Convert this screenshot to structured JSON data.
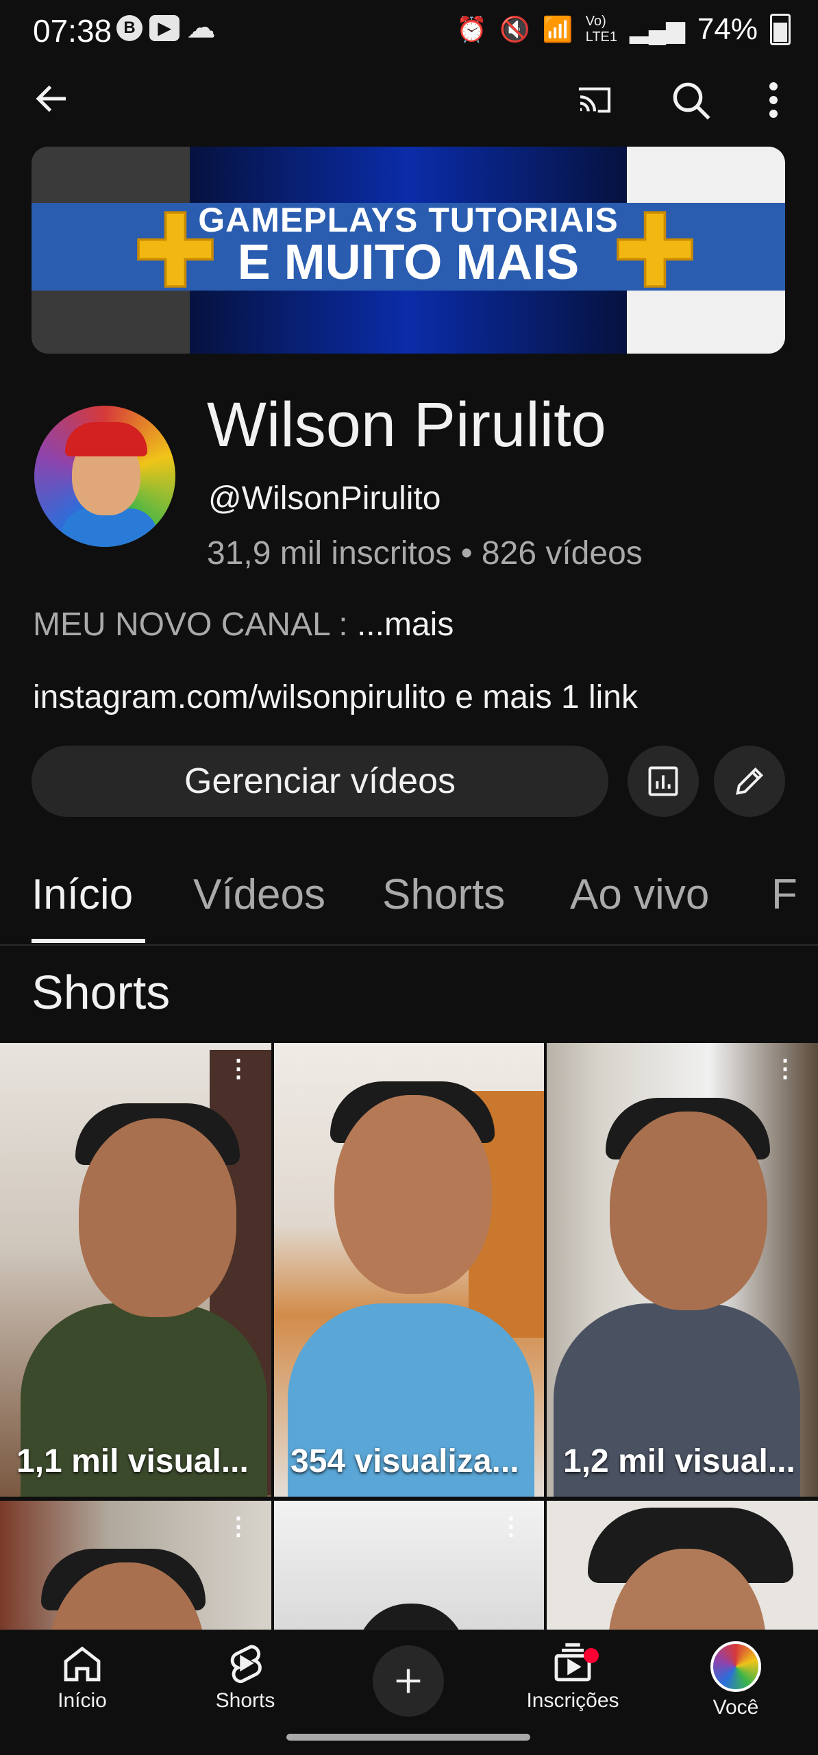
{
  "status_bar": {
    "time": "07:38",
    "left_icons": [
      "b-icon",
      "youtube-icon",
      "cloud-icon"
    ],
    "right_icons": [
      "alarm-icon",
      "mute-icon",
      "wifi-icon",
      "volte-icon",
      "signal-icon"
    ],
    "battery": "74%"
  },
  "appbar": {
    "icons": [
      "back-arrow-icon",
      "cast-icon",
      "search-icon",
      "more-vert-icon"
    ]
  },
  "banner": {
    "line1": "GAMEPLAYS TUTORIAIS",
    "line2": "E MUITO MAIS"
  },
  "channel": {
    "name": "Wilson Pirulito",
    "handle": "@WilsonPirulito",
    "stats": "31,9 mil inscritos • 826 vídeos",
    "description": "MEU NOVO CANAL : ",
    "description_more": "...mais",
    "link": "instagram.com/wilsonpirulito",
    "link_more": "e mais 1 link",
    "manage_label": "Gerenciar vídeos"
  },
  "tabs": [
    "Início",
    "Vídeos",
    "Shorts",
    "Ao vivo",
    "F"
  ],
  "active_tab": "Início",
  "section_title": "Shorts",
  "shorts": [
    {
      "views": "1,1 mil visual..."
    },
    {
      "views": "354 visualiza..."
    },
    {
      "views": "1,2 mil visual..."
    },
    {
      "views": ""
    },
    {
      "views": ""
    },
    {
      "views": ""
    }
  ],
  "bottom_nav": {
    "home": "Início",
    "shorts": "Shorts",
    "subscriptions": "Inscrições",
    "you": "Você"
  },
  "colors": {
    "background": "#0f0f0f",
    "surface": "#272727",
    "secondary_text": "#aaaaaa",
    "notification": "#ff0033"
  }
}
